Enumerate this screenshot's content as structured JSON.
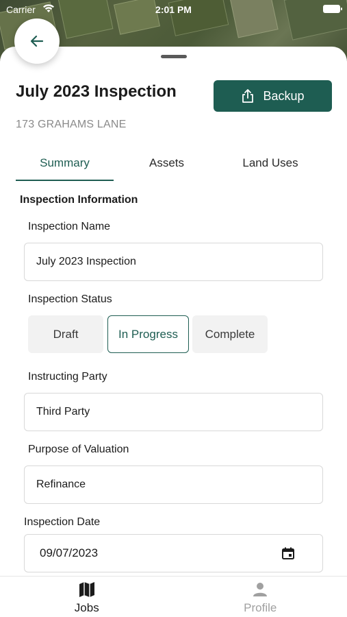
{
  "status_bar": {
    "carrier": "Carrier",
    "time": "2:01 PM"
  },
  "header": {
    "title": "July 2023 Inspection",
    "address": "173 GRAHAMS LANE",
    "backup_label": "Backup"
  },
  "tabs": [
    {
      "label": "Summary",
      "active": true
    },
    {
      "label": "Assets",
      "active": false
    },
    {
      "label": "Land Uses",
      "active": false
    }
  ],
  "form": {
    "section_title": "Inspection Information",
    "inspection_name": {
      "label": "Inspection Name",
      "value": "July 2023 Inspection"
    },
    "inspection_status": {
      "label": "Inspection Status",
      "options": [
        "Draft",
        "In Progress",
        "Complete"
      ],
      "selected": "In Progress"
    },
    "instructing_party": {
      "label": "Instructing Party",
      "value": "Third Party"
    },
    "purpose_of_valuation": {
      "label": "Purpose of Valuation",
      "value": "Refinance"
    },
    "inspection_date": {
      "label": "Inspection Date",
      "value": "09/07/2023"
    }
  },
  "bottom_nav": [
    {
      "label": "Jobs",
      "icon": "map-icon",
      "active": true
    },
    {
      "label": "Profile",
      "icon": "person-icon",
      "active": false
    }
  ],
  "colors": {
    "accent": "#1e5d52",
    "muted": "#8a8a8a",
    "inactive_nav": "#a0a0a0"
  }
}
